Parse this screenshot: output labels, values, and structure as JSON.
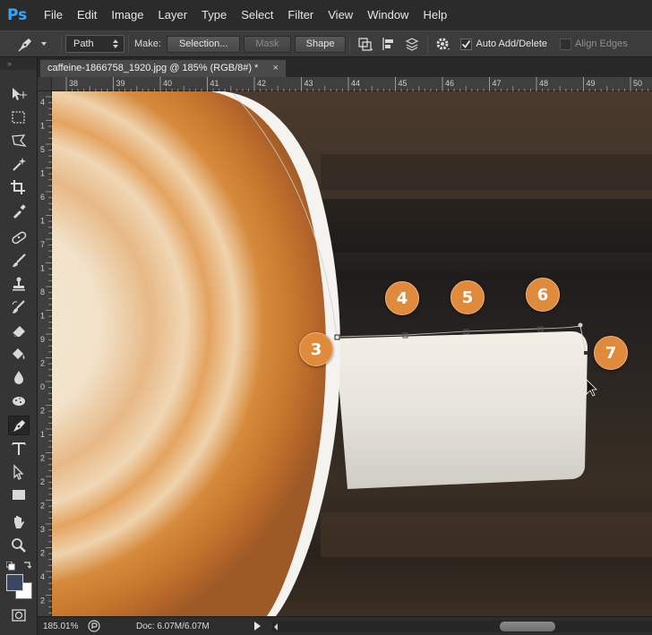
{
  "app": {
    "logo": "Ps"
  },
  "menu": [
    "File",
    "Edit",
    "Image",
    "Layer",
    "Type",
    "Select",
    "Filter",
    "View",
    "Window",
    "Help"
  ],
  "options": {
    "tool_icon": "pen-icon",
    "mode_value": "Path",
    "make_label": "Make:",
    "selection_label": "Selection...",
    "mask_label": "Mask",
    "shape_label": "Shape",
    "auto_add_delete_label": "Auto Add/Delete",
    "auto_add_delete_checked": true,
    "align_edges_label": "Align Edges",
    "align_edges_checked": false
  },
  "document": {
    "tab_title": "caffeine-1866758_1920.jpg @ 185% (RGB/8#) *",
    "close_glyph": "×"
  },
  "ruler": {
    "top_labels": [
      "38",
      "39",
      "40",
      "41",
      "42",
      "43",
      "44",
      "45",
      "46",
      "47",
      "48",
      "49",
      "50"
    ],
    "left_labels": [
      "4",
      "1",
      "5",
      "1",
      "6",
      "1",
      "7",
      "1",
      "8",
      "1",
      "9",
      "2",
      "0",
      "2",
      "1",
      "2",
      "2",
      "2",
      "3",
      "2",
      "4",
      "2"
    ]
  },
  "steps": [
    "3",
    "4",
    "5",
    "6",
    "7"
  ],
  "status": {
    "zoom": "185.01%",
    "doc_info": "Doc: 6.07M/6.07M"
  },
  "colors": {
    "foreground": "#3a4660",
    "background": "#ffffff",
    "step_badge": "#e08a3c",
    "ps_blue": "#31a8ff"
  }
}
